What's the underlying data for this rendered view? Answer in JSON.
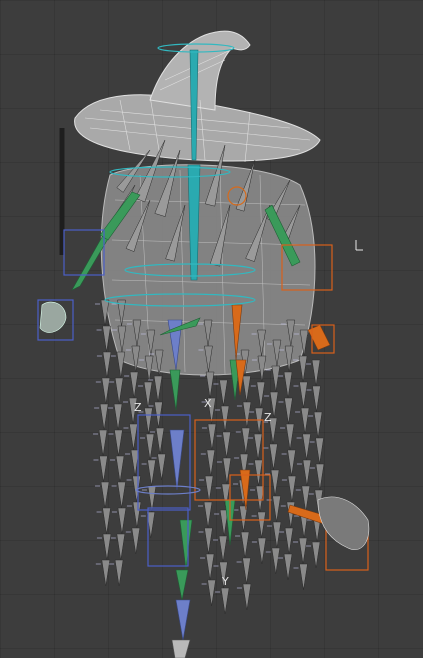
{
  "viewport": {
    "colors": {
      "background": "#3d3d3d",
      "mesh_wire": "#d8d8d8",
      "bone_gray": "#8a8a8a",
      "bone_green": "#3a9a5a",
      "bone_blue": "#6d7fc9",
      "bone_teal": "#2aaab0",
      "bone_orange": "#d86a1a",
      "control_blue": "#4b5fc8",
      "control_orange": "#d8601c",
      "control_teal": "#32b8c0"
    },
    "icons": [
      "empty-axes-icon",
      "staff-object-icon"
    ],
    "axis_labels": {
      "left_z": "Z",
      "left_x": "X",
      "right_z": "Z",
      "lower_y": "Y"
    }
  }
}
